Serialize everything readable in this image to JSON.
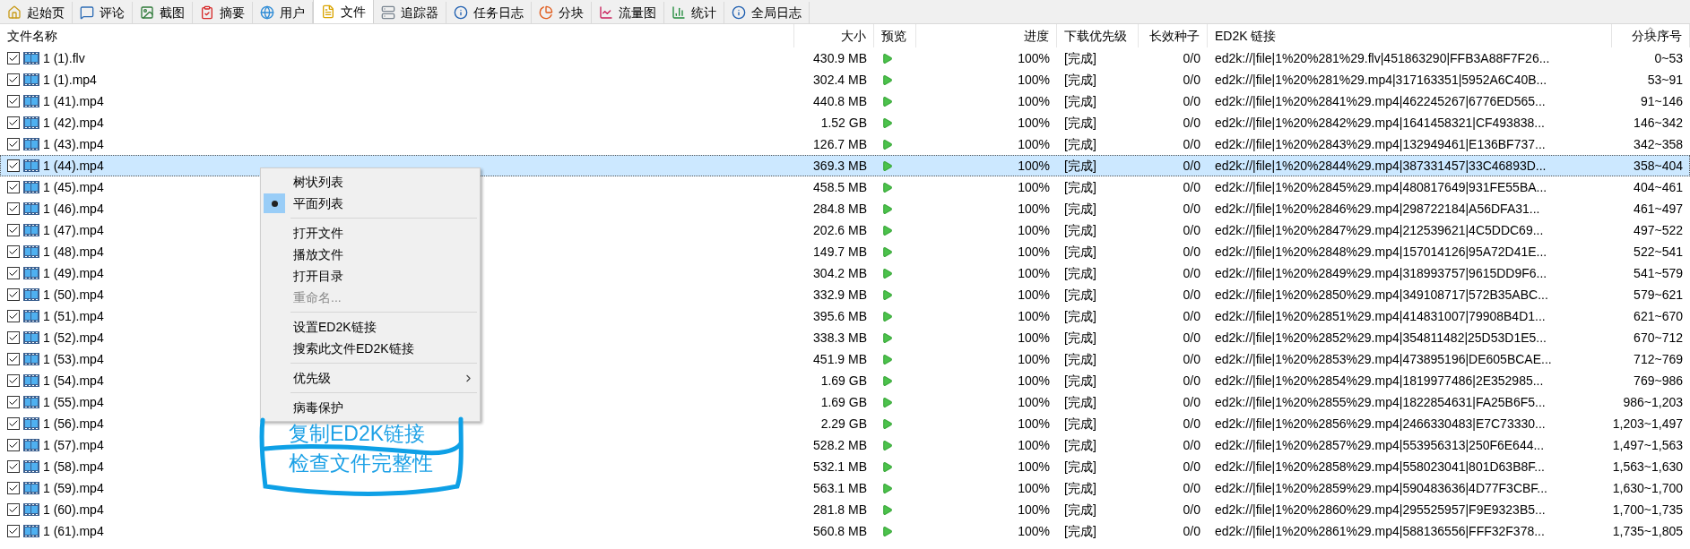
{
  "tabs": [
    {
      "label": "起始页",
      "selected": false
    },
    {
      "label": "评论",
      "selected": false
    },
    {
      "label": "截图",
      "selected": false
    },
    {
      "label": "摘要",
      "selected": false
    },
    {
      "label": "用户",
      "selected": false
    },
    {
      "label": "文件",
      "selected": true
    },
    {
      "label": "追踪器",
      "selected": false
    },
    {
      "label": "任务日志",
      "selected": false
    },
    {
      "label": "分块",
      "selected": false
    },
    {
      "label": "流量图",
      "selected": false
    },
    {
      "label": "统计",
      "selected": false
    },
    {
      "label": "全局日志",
      "selected": false
    }
  ],
  "table": {
    "columns": [
      {
        "label": "文件名称",
        "sorted": false
      },
      {
        "label": "大小",
        "sorted": false
      },
      {
        "label": "预览",
        "sorted": false
      },
      {
        "label": "进度",
        "sorted": false
      },
      {
        "label": "下载优先级",
        "sorted": false
      },
      {
        "label": "长效种子",
        "sorted": false
      },
      {
        "label": "ED2K 链接",
        "sorted": false
      },
      {
        "label": "分块序号",
        "sorted": true
      }
    ],
    "rows": [
      {
        "checked": true,
        "selected": false,
        "name": "1 (1).flv",
        "size": "430.9 MB",
        "progress": "100%",
        "priority": "[完成]",
        "seeds": "0/0",
        "ed2k": "ed2k://|file|1%20%281%29.flv|451863290|FFB3A88F7F26...",
        "chunks": "0~53"
      },
      {
        "checked": true,
        "selected": false,
        "name": "1 (1).mp4",
        "size": "302.4 MB",
        "progress": "100%",
        "priority": "[完成]",
        "seeds": "0/0",
        "ed2k": "ed2k://|file|1%20%281%29.mp4|317163351|5952A6C40B...",
        "chunks": "53~91"
      },
      {
        "checked": true,
        "selected": false,
        "name": "1 (41).mp4",
        "size": "440.8 MB",
        "progress": "100%",
        "priority": "[完成]",
        "seeds": "0/0",
        "ed2k": "ed2k://|file|1%20%2841%29.mp4|462245267|6776ED565...",
        "chunks": "91~146"
      },
      {
        "checked": true,
        "selected": false,
        "name": "1 (42).mp4",
        "size": "1.52 GB",
        "progress": "100%",
        "priority": "[完成]",
        "seeds": "0/0",
        "ed2k": "ed2k://|file|1%20%2842%29.mp4|1641458321|CF493838...",
        "chunks": "146~342"
      },
      {
        "checked": true,
        "selected": false,
        "name": "1 (43).mp4",
        "size": "126.7 MB",
        "progress": "100%",
        "priority": "[完成]",
        "seeds": "0/0",
        "ed2k": "ed2k://|file|1%20%2843%29.mp4|132949461|E136BF737...",
        "chunks": "342~358"
      },
      {
        "checked": true,
        "selected": true,
        "name": "1 (44).mp4",
        "size": "369.3 MB",
        "progress": "100%",
        "priority": "[完成]",
        "seeds": "0/0",
        "ed2k": "ed2k://|file|1%20%2844%29.mp4|387331457|33C46893D...",
        "chunks": "358~404"
      },
      {
        "checked": true,
        "selected": false,
        "name": "1 (45).mp4",
        "size": "458.5 MB",
        "progress": "100%",
        "priority": "[完成]",
        "seeds": "0/0",
        "ed2k": "ed2k://|file|1%20%2845%29.mp4|480817649|931FE55BA...",
        "chunks": "404~461"
      },
      {
        "checked": true,
        "selected": false,
        "name": "1 (46).mp4",
        "size": "284.8 MB",
        "progress": "100%",
        "priority": "[完成]",
        "seeds": "0/0",
        "ed2k": "ed2k://|file|1%20%2846%29.mp4|298722184|A56DFA31...",
        "chunks": "461~497"
      },
      {
        "checked": true,
        "selected": false,
        "name": "1 (47).mp4",
        "size": "202.6 MB",
        "progress": "100%",
        "priority": "[完成]",
        "seeds": "0/0",
        "ed2k": "ed2k://|file|1%20%2847%29.mp4|212539621|4C5DDC69...",
        "chunks": "497~522"
      },
      {
        "checked": true,
        "selected": false,
        "name": "1 (48).mp4",
        "size": "149.7 MB",
        "progress": "100%",
        "priority": "[完成]",
        "seeds": "0/0",
        "ed2k": "ed2k://|file|1%20%2848%29.mp4|157014126|95A72D41E...",
        "chunks": "522~541"
      },
      {
        "checked": true,
        "selected": false,
        "name": "1 (49).mp4",
        "size": "304.2 MB",
        "progress": "100%",
        "priority": "[完成]",
        "seeds": "0/0",
        "ed2k": "ed2k://|file|1%20%2849%29.mp4|318993757|9615DD9F6...",
        "chunks": "541~579"
      },
      {
        "checked": true,
        "selected": false,
        "name": "1 (50).mp4",
        "size": "332.9 MB",
        "progress": "100%",
        "priority": "[完成]",
        "seeds": "0/0",
        "ed2k": "ed2k://|file|1%20%2850%29.mp4|349108717|572B35ABC...",
        "chunks": "579~621"
      },
      {
        "checked": true,
        "selected": false,
        "name": "1 (51).mp4",
        "size": "395.6 MB",
        "progress": "100%",
        "priority": "[完成]",
        "seeds": "0/0",
        "ed2k": "ed2k://|file|1%20%2851%29.mp4|414831007|79908B4D1...",
        "chunks": "621~670"
      },
      {
        "checked": true,
        "selected": false,
        "name": "1 (52).mp4",
        "size": "338.3 MB",
        "progress": "100%",
        "priority": "[完成]",
        "seeds": "0/0",
        "ed2k": "ed2k://|file|1%20%2852%29.mp4|354811482|25D53D1E5...",
        "chunks": "670~712"
      },
      {
        "checked": true,
        "selected": false,
        "name": "1 (53).mp4",
        "size": "451.9 MB",
        "progress": "100%",
        "priority": "[完成]",
        "seeds": "0/0",
        "ed2k": "ed2k://|file|1%20%2853%29.mp4|473895196|DE605BCAE...",
        "chunks": "712~769"
      },
      {
        "checked": true,
        "selected": false,
        "name": "1 (54).mp4",
        "size": "1.69 GB",
        "progress": "100%",
        "priority": "[完成]",
        "seeds": "0/0",
        "ed2k": "ed2k://|file|1%20%2854%29.mp4|1819977486|2E352985...",
        "chunks": "769~986"
      },
      {
        "checked": true,
        "selected": false,
        "name": "1 (55).mp4",
        "size": "1.69 GB",
        "progress": "100%",
        "priority": "[完成]",
        "seeds": "0/0",
        "ed2k": "ed2k://|file|1%20%2855%29.mp4|1822854631|FA25B6F5...",
        "chunks": "986~1,203"
      },
      {
        "checked": true,
        "selected": false,
        "name": "1 (56).mp4",
        "size": "2.29 GB",
        "progress": "100%",
        "priority": "[完成]",
        "seeds": "0/0",
        "ed2k": "ed2k://|file|1%20%2856%29.mp4|2466330483|E7C73330...",
        "chunks": "1,203~1,497"
      },
      {
        "checked": true,
        "selected": false,
        "name": "1 (57).mp4",
        "size": "528.2 MB",
        "progress": "100%",
        "priority": "[完成]",
        "seeds": "0/0",
        "ed2k": "ed2k://|file|1%20%2857%29.mp4|553956313|250F6E644...",
        "chunks": "1,497~1,563"
      },
      {
        "checked": true,
        "selected": false,
        "name": "1 (58).mp4",
        "size": "532.1 MB",
        "progress": "100%",
        "priority": "[完成]",
        "seeds": "0/0",
        "ed2k": "ed2k://|file|1%20%2858%29.mp4|558023041|801D63B8F...",
        "chunks": "1,563~1,630"
      },
      {
        "checked": true,
        "selected": false,
        "name": "1 (59).mp4",
        "size": "563.1 MB",
        "progress": "100%",
        "priority": "[完成]",
        "seeds": "0/0",
        "ed2k": "ed2k://|file|1%20%2859%29.mp4|590483636|4D77F3CBF...",
        "chunks": "1,630~1,700"
      },
      {
        "checked": true,
        "selected": false,
        "name": "1 (60).mp4",
        "size": "281.8 MB",
        "progress": "100%",
        "priority": "[完成]",
        "seeds": "0/0",
        "ed2k": "ed2k://|file|1%20%2860%29.mp4|295525957|F9E9323B5...",
        "chunks": "1,700~1,735"
      },
      {
        "checked": true,
        "selected": false,
        "name": "1 (61).mp4",
        "size": "560.8 MB",
        "progress": "100%",
        "priority": "[完成]",
        "seeds": "0/0",
        "ed2k": "ed2k://|file|1%20%2861%29.mp4|588136556|FFF32F378...",
        "chunks": "1,735~1,805"
      }
    ]
  },
  "context_menu": {
    "items": [
      {
        "kind": "item",
        "label": "树状列表",
        "selected": false,
        "disabled": false,
        "submenu": false
      },
      {
        "kind": "item",
        "label": "平面列表",
        "selected": true,
        "disabled": false,
        "submenu": false
      },
      {
        "kind": "separator"
      },
      {
        "kind": "item",
        "label": "打开文件",
        "selected": false,
        "disabled": false,
        "submenu": false
      },
      {
        "kind": "item",
        "label": "播放文件",
        "selected": false,
        "disabled": false,
        "submenu": false
      },
      {
        "kind": "item",
        "label": "打开目录",
        "selected": false,
        "disabled": false,
        "submenu": false
      },
      {
        "kind": "item",
        "label": "重命名...",
        "selected": false,
        "disabled": true,
        "submenu": false
      },
      {
        "kind": "separator"
      },
      {
        "kind": "item",
        "label": "设置ED2K链接",
        "selected": false,
        "disabled": false,
        "submenu": false
      },
      {
        "kind": "item",
        "label": "搜索此文件ED2K链接",
        "selected": false,
        "disabled": false,
        "submenu": false
      },
      {
        "kind": "separator"
      },
      {
        "kind": "item",
        "label": "优先级",
        "selected": false,
        "disabled": false,
        "submenu": true
      },
      {
        "kind": "separator"
      },
      {
        "kind": "item",
        "label": "病毒保护",
        "selected": false,
        "disabled": false,
        "submenu": false
      }
    ]
  },
  "annotation": {
    "lines": [
      "复制ED2K链接",
      "检查文件完整性"
    ]
  }
}
